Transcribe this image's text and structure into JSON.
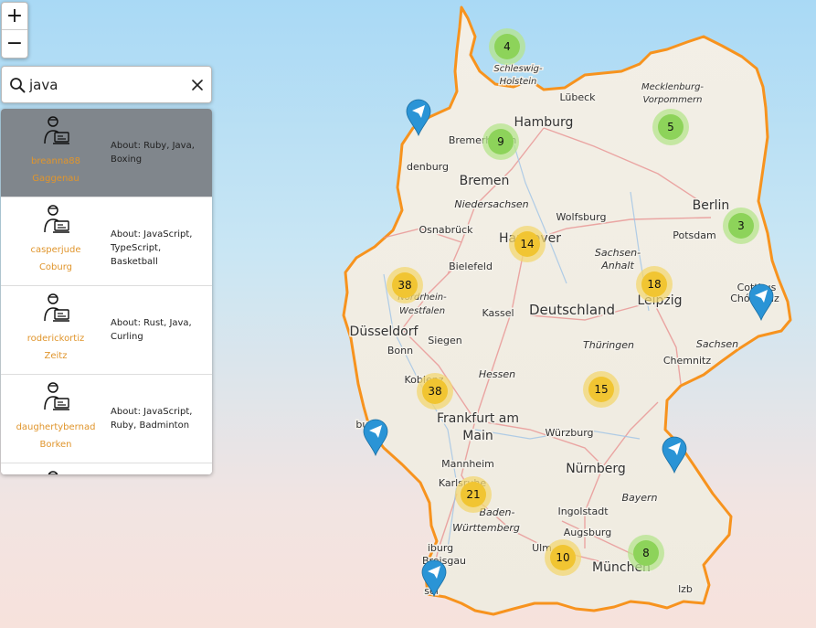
{
  "map": {
    "places": [
      {
        "name": "Schleswig-",
        "cls": "region"
      },
      {
        "name": "Holstein",
        "cls": "region"
      },
      {
        "name": "Mecklenburg-",
        "cls": "region"
      },
      {
        "name": "Vorpommern",
        "cls": "region"
      },
      {
        "name": "Lübeck",
        "cls": "small"
      },
      {
        "name": "Hamburg",
        "cls": "city"
      },
      {
        "name": "Bremerhaven",
        "cls": "small"
      },
      {
        "name": "denburg",
        "cls": "small"
      },
      {
        "name": "Bremen",
        "cls": "city"
      },
      {
        "name": "Niedersachsen",
        "cls": "region"
      },
      {
        "name": "Berlin",
        "cls": "city"
      },
      {
        "name": "Potsdam",
        "cls": "small"
      },
      {
        "name": "Wolfsburg",
        "cls": "small"
      },
      {
        "name": "Osnabrück",
        "cls": "small"
      },
      {
        "name": "Hannover",
        "cls": "city"
      },
      {
        "name": "Sachsen-",
        "cls": "region"
      },
      {
        "name": "Anhalt",
        "cls": "region"
      },
      {
        "name": "Bielefeld",
        "cls": "small"
      },
      {
        "name": "Nordrhein-",
        "cls": "region"
      },
      {
        "name": "Westfalen",
        "cls": "region"
      },
      {
        "name": "Leipzig",
        "cls": "city"
      },
      {
        "name": "Cottbus",
        "cls": "small"
      },
      {
        "name": "Chóśebuz",
        "cls": "small"
      },
      {
        "name": "Kassel",
        "cls": "small"
      },
      {
        "name": "Deutschland",
        "cls": "country"
      },
      {
        "name": "Düsseldorf",
        "cls": "city"
      },
      {
        "name": "Siegen",
        "cls": "small"
      },
      {
        "name": "Bonn",
        "cls": "small"
      },
      {
        "name": "Thüringen",
        "cls": "region"
      },
      {
        "name": "Sachsen",
        "cls": "region"
      },
      {
        "name": "Chemnitz",
        "cls": "small"
      },
      {
        "name": "Koblenz",
        "cls": "small"
      },
      {
        "name": "Hessen",
        "cls": "region"
      },
      {
        "name": "Frankfurt am",
        "cls": "city"
      },
      {
        "name": "Main",
        "cls": "city"
      },
      {
        "name": "Würzburg",
        "cls": "small"
      },
      {
        "name": "burg",
        "cls": "small"
      },
      {
        "name": "Mannheim",
        "cls": "small"
      },
      {
        "name": "Nürnberg",
        "cls": "city"
      },
      {
        "name": "Karlsruhe",
        "cls": "small"
      },
      {
        "name": "Bayern",
        "cls": "region"
      },
      {
        "name": "Baden-",
        "cls": "region"
      },
      {
        "name": "Württemberg",
        "cls": "region"
      },
      {
        "name": "Ingolstadt",
        "cls": "small"
      },
      {
        "name": "Augsburg",
        "cls": "small"
      },
      {
        "name": "Ulm",
        "cls": "small"
      },
      {
        "name": "iburg",
        "cls": "small"
      },
      {
        "name": "Breisgau",
        "cls": "small"
      },
      {
        "name": "München",
        "cls": "city"
      },
      {
        "name": "lzb",
        "cls": "small"
      },
      {
        "name": "sel",
        "cls": "small"
      }
    ],
    "clusters": [
      {
        "count": 4,
        "level": "green"
      },
      {
        "count": 9,
        "level": "green"
      },
      {
        "count": 5,
        "level": "green"
      },
      {
        "count": 3,
        "level": "green"
      },
      {
        "count": 14,
        "level": "yellow"
      },
      {
        "count": 38,
        "level": "yellow"
      },
      {
        "count": 18,
        "level": "yellow"
      },
      {
        "count": 38,
        "level": "yellow"
      },
      {
        "count": 15,
        "level": "yellow"
      },
      {
        "count": 21,
        "level": "yellow"
      },
      {
        "count": 10,
        "level": "yellow"
      },
      {
        "count": 8,
        "level": "green"
      }
    ],
    "cluster_colors": {
      "green": {
        "fill": "#8dd35a",
        "halo": "#b5e48c"
      },
      "yellow": {
        "fill": "#f1c532",
        "halo": "#f3d772"
      }
    },
    "marker_color": "#2a94d6",
    "border_color": "#f7931e"
  },
  "zoom": {
    "in_label": "+",
    "out_label": "−"
  },
  "search": {
    "query": "java"
  },
  "results": [
    {
      "username": "breanna88",
      "city": "Gaggenau",
      "about": "About: Ruby, Java, Boxing",
      "selected": true
    },
    {
      "username": "casperjude",
      "city": "Coburg",
      "about": "About: JavaScript, TypeScript, Basketball",
      "selected": false
    },
    {
      "username": "roderickortiz",
      "city": "Zeitz",
      "about": "About: Rust, Java, Curling",
      "selected": false
    },
    {
      "username": "daughertybernad",
      "city": "Borken",
      "about": "About: JavaScript, Ruby, Badminton",
      "selected": false
    }
  ]
}
